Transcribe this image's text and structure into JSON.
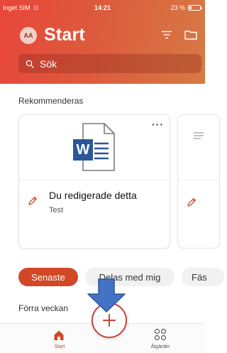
{
  "status_bar": {
    "carrier": "Inget SIM",
    "time": "14:21",
    "battery": "23 %"
  },
  "header": {
    "avatar_initials": "AA",
    "title": "Start",
    "icons": [
      "filter-icon",
      "folder-icon"
    ]
  },
  "search": {
    "placeholder": "Sök"
  },
  "recommended": {
    "section_title": "Rekommenderas",
    "cards": [
      {
        "file_icon": "word-document-icon",
        "name": "Du redigerade detta",
        "subtitle": "Test",
        "action_icon": "edit-icon",
        "menu_icon": "more-icon"
      },
      {
        "file_icon": "document-lines-icon",
        "action_icon": "edit-icon"
      }
    ]
  },
  "filters": {
    "pills": [
      "Senaste",
      "Delas med mig",
      "Fäs"
    ],
    "selected": "Senaste"
  },
  "recent": {
    "section_title": "Förra veckan"
  },
  "tabbar": {
    "tabs": [
      {
        "label": "Start",
        "icon": "home-icon",
        "active": true
      },
      {
        "label": "Åtgärder",
        "icon": "grid-icon",
        "active": false
      }
    ],
    "create_button_icon": "plus-icon"
  },
  "colors": {
    "brand": "#d24726",
    "header_gradient_start": "#e8463a",
    "header_gradient_end": "#d67a45",
    "word_blue": "#2b579a",
    "guide_arrow": "#4472c4"
  }
}
